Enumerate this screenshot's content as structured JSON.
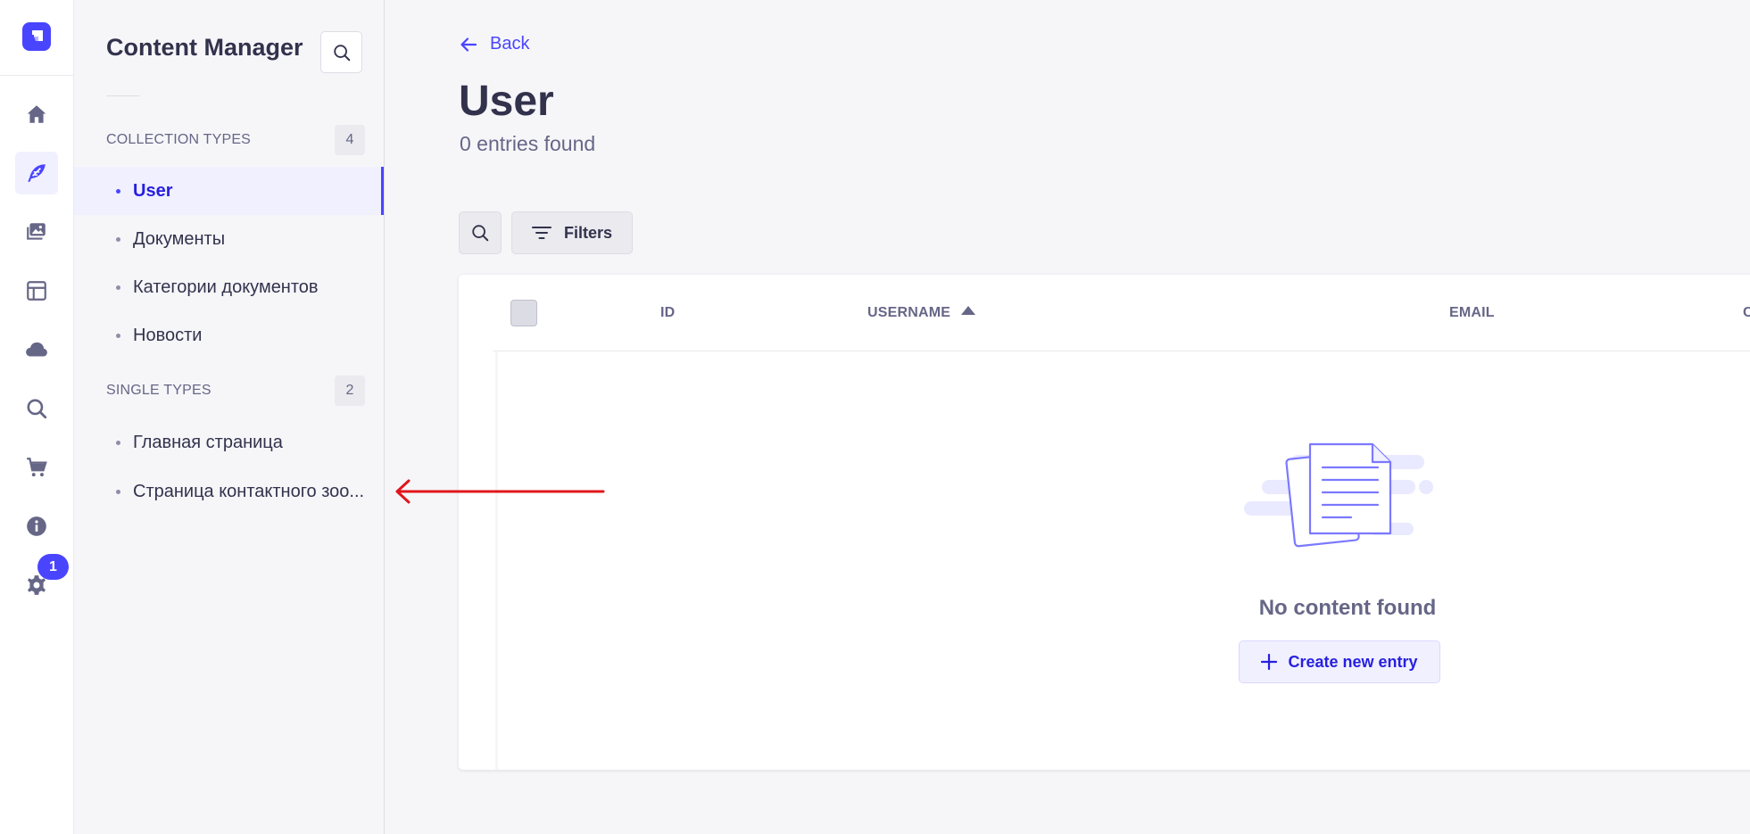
{
  "nav_rail": {
    "items": [
      {
        "icon": "home-icon"
      },
      {
        "icon": "content-manager-icon",
        "active": true
      },
      {
        "icon": "media-library-icon"
      },
      {
        "icon": "layout-builder-icon"
      },
      {
        "icon": "cloud-icon"
      },
      {
        "icon": "search-icon"
      },
      {
        "icon": "marketplace-cart-icon"
      },
      {
        "icon": "info-icon"
      },
      {
        "icon": "settings-gear-icon"
      }
    ],
    "settings_badge": "1"
  },
  "subnav": {
    "title": "Content Manager",
    "collection_types": {
      "label": "COLLECTION TYPES",
      "count": "4",
      "items": [
        "User",
        "Документы",
        "Категории документов",
        "Новости"
      ]
    },
    "single_types": {
      "label": "SINGLE TYPES",
      "count": "2",
      "items": [
        "Главная страница",
        "Страница контактного зоо..."
      ]
    }
  },
  "main": {
    "back_label": "Back",
    "title": "User",
    "subtitle": "0 entries found",
    "filters_label": "Filters",
    "table": {
      "columns": [
        "ID",
        "USERNAME",
        "EMAIL",
        "C"
      ],
      "sort_column": "USERNAME",
      "sort_direction": "ascending",
      "empty_text": "No content found",
      "create_label": "Create new entry"
    }
  },
  "colors": {
    "primary": "#4945ff",
    "annotation_arrow": "#e0161b"
  }
}
